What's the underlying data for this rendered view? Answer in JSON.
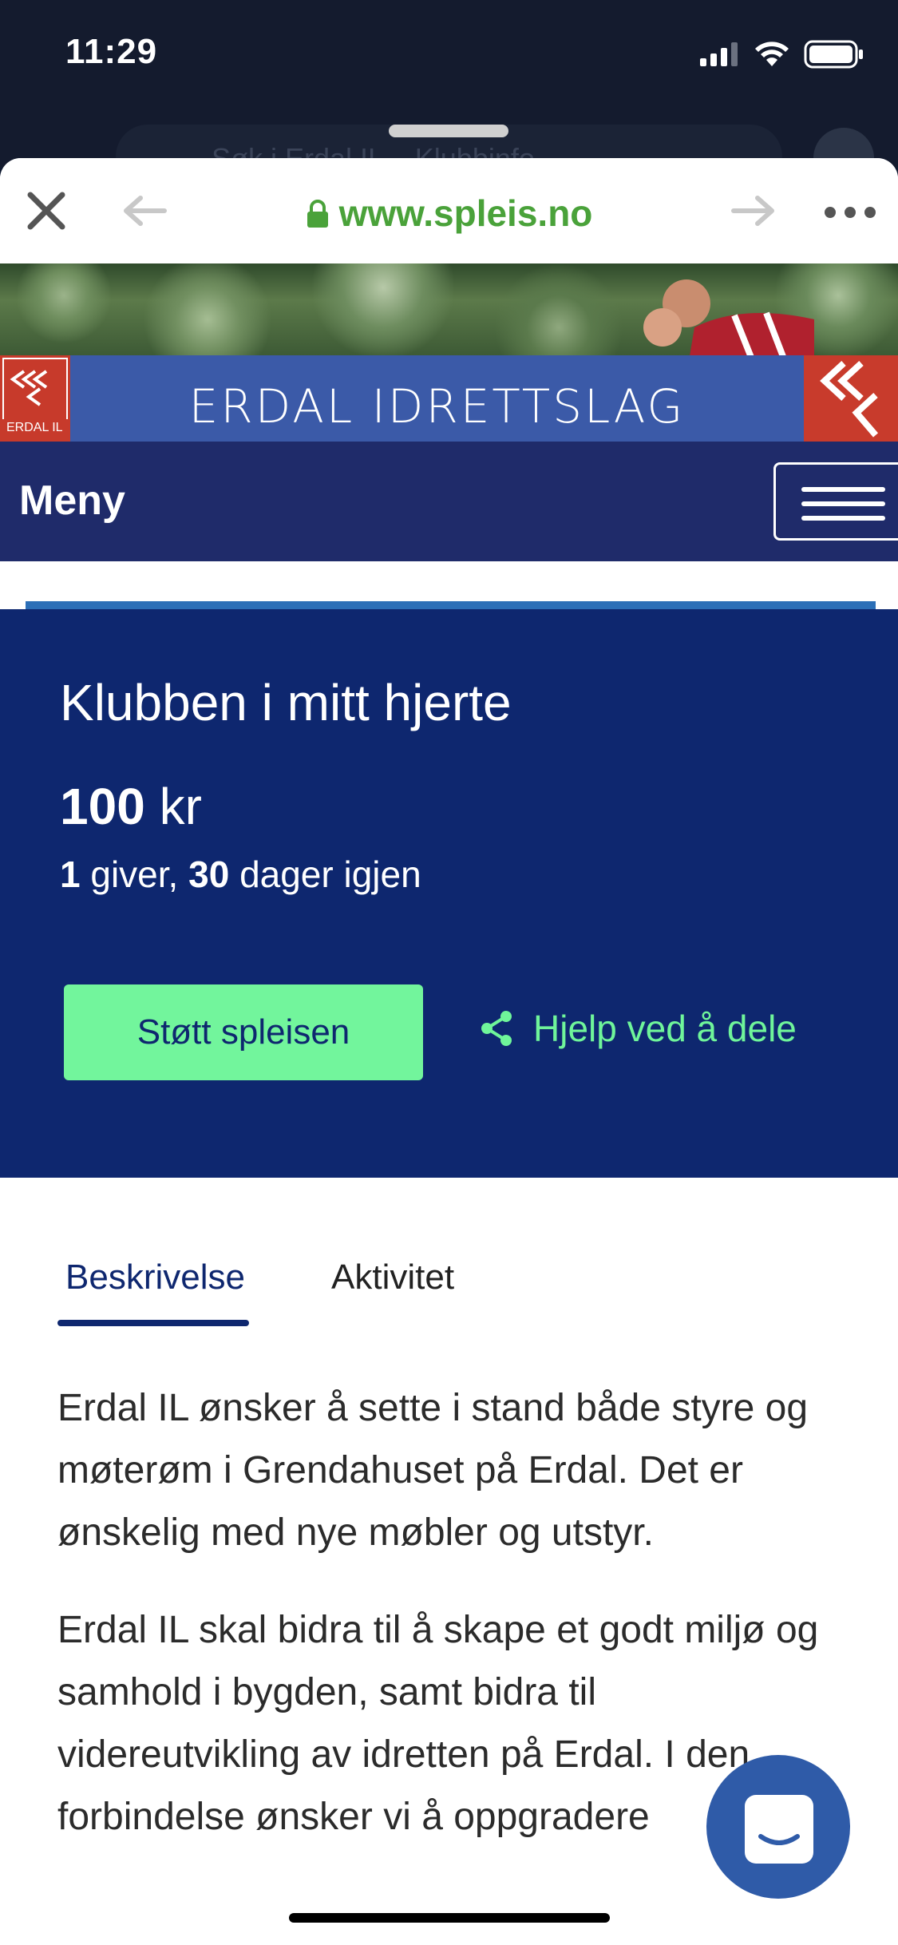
{
  "status_bar": {
    "time": "11:29"
  },
  "background_browser": {
    "search_placeholder": "Søk i Erdal IL – Klubbinfo"
  },
  "browser": {
    "url": "www.spleis.no"
  },
  "site": {
    "banner_title": "ERDAL IDRETTSLAG",
    "logo_text": "ERDAL IL",
    "menu_label": "Meny"
  },
  "campaign": {
    "title": "Klubben i mitt hjerte",
    "amount_value": "100",
    "amount_unit": "kr",
    "givers": "1",
    "givers_label": "giver,",
    "days": "30",
    "days_label": "dager igjen",
    "support_button": "Støtt spleisen",
    "share_link": "Hjelp ved å dele"
  },
  "tabs": [
    {
      "label": "Beskrivelse",
      "active": true
    },
    {
      "label": "Aktivitet",
      "active": false
    }
  ],
  "description": [
    "Erdal IL ønsker å sette i stand både styre og møterøm i Grendahuset på Erdal. Det er ønskelig med nye møbler og utstyr.",
    "Erdal IL skal bidra til å skape et godt miljø og samhold i bygden, samt bidra til videreutvikling av idretten på Erdal. I den forbindelse ønsker vi å oppgradere"
  ],
  "colors": {
    "navy": "#0e276f",
    "accent_green": "#72f59c",
    "url_green": "#4aa23a",
    "menu_bar": "#1f2b6a",
    "chat_blue": "#2f5ba8"
  }
}
